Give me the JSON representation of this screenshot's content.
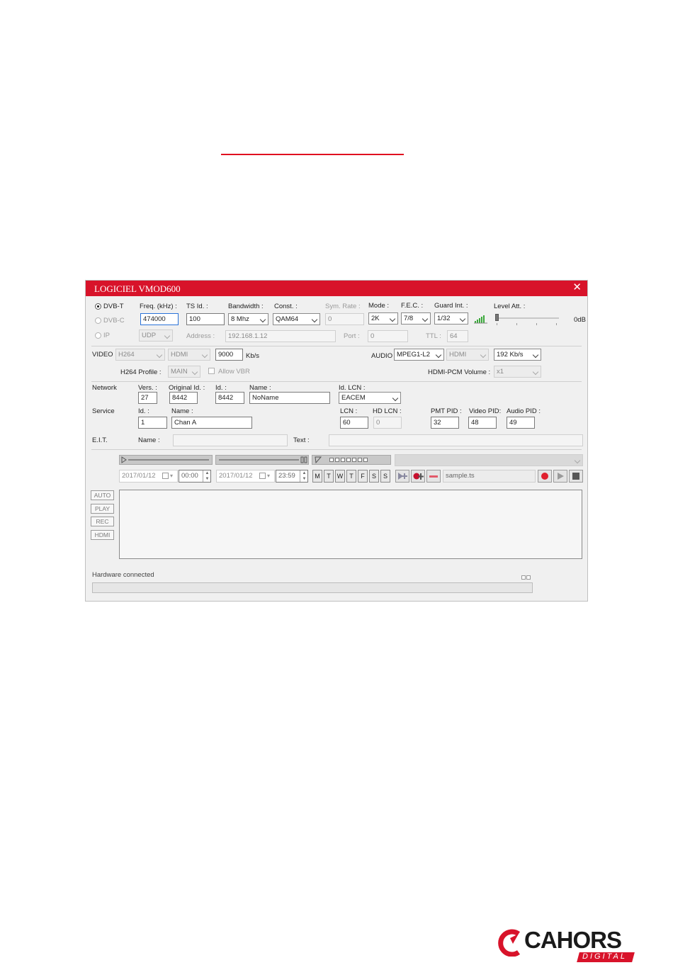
{
  "window": {
    "title": "LOGICIEL VMOD600",
    "close": "✕"
  },
  "std": {
    "dvbt": "DVB-T",
    "dvbc": "DVB-C",
    "ip": "IP"
  },
  "tuner": {
    "freq_label": "Freq. (kHz) :",
    "freq": "474000",
    "tsid_label": "TS Id. :",
    "tsid": "100",
    "bw_label": "Bandwidth :",
    "bw": "8 Mhz",
    "const_label": "Const. :",
    "const": "QAM64",
    "symrate_label": "Sym. Rate :",
    "symrate": "0",
    "mode_label": "Mode :",
    "mode": "2K",
    "fec_label": "F.E.C. :",
    "fec": "7/8",
    "guard_label": "Guard Int. :",
    "guard": "1/32",
    "level_label": "Level Att. :",
    "level_value": "0dB"
  },
  "ip": {
    "proto": "UDP",
    "addr_label": "Address :",
    "addr": "192.168.1.12",
    "port_label": "Port :",
    "port": "0",
    "ttl_label": "TTL :",
    "ttl": "64"
  },
  "video": {
    "label": "VIDEO",
    "codec": "H264",
    "source": "HDMI",
    "rate": "9000",
    "unit": "Kb/s",
    "profile_label": "H264 Profile :",
    "profile": "MAIN",
    "vbr": "Allow VBR"
  },
  "audio": {
    "label": "AUDIO",
    "codec": "MPEG1-L2",
    "source": "HDMI",
    "rate": "192 Kb/s",
    "volume_label": "HDMI-PCM Volume :",
    "volume": "x1"
  },
  "network": {
    "label": "Network",
    "vers_label": "Vers. :",
    "vers": "27",
    "orig_label": "Original Id. :",
    "orig": "8442",
    "id_label": "Id. :",
    "id": "8442",
    "name_label": "Name :",
    "name": "NoName",
    "lcn_id_label": "Id. LCN :",
    "lcn_id": "EACEM"
  },
  "service": {
    "label": "Service",
    "id_label": "Id. :",
    "id": "1",
    "name_label": "Name :",
    "name": "Chan A",
    "lcn_label": "LCN :",
    "lcn": "60",
    "hdlcn_label": "HD LCN :",
    "hdlcn": "0",
    "pmt_label": "PMT PID :",
    "pmt": "32",
    "vpid_label": "Video PID:",
    "vpid": "48",
    "apid_label": "Audio PID :",
    "apid": "49"
  },
  "eit": {
    "label": "E.I.T.",
    "name_label": "Name :",
    "text_label": "Text :"
  },
  "schedule": {
    "start_date": "2017/01/12",
    "start_time": "00:00",
    "end_date": "2017/01/12",
    "end_time": "23:59",
    "days": [
      "M",
      "T",
      "W",
      "T",
      "F",
      "S",
      "S"
    ],
    "file": "sample.ts"
  },
  "side": [
    "AUTO",
    "PLAY",
    "REC",
    "HDMI"
  ],
  "status": {
    "text": "Hardware connected"
  },
  "logo": {
    "name": "CAHORS",
    "sub": "DIGITAL"
  },
  "colors": {
    "accent": "#d8132a"
  }
}
